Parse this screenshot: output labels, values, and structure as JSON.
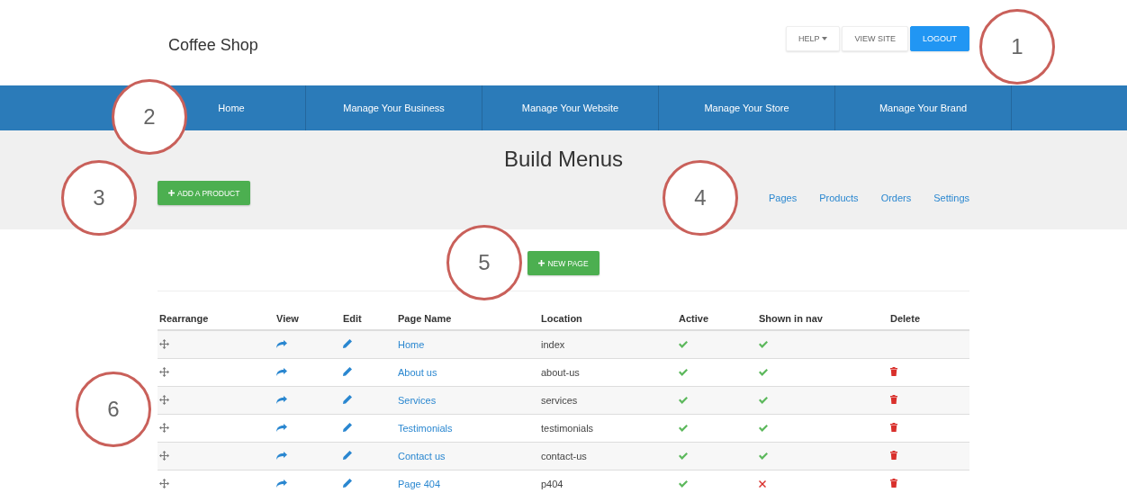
{
  "header": {
    "brand": "Coffee Shop",
    "buttons": [
      {
        "label": "HELP",
        "kind": "dropdown"
      },
      {
        "label": "VIEW SITE",
        "kind": "default"
      },
      {
        "label": "LOGOUT",
        "kind": "primary"
      }
    ]
  },
  "nav": [
    {
      "label": "Home"
    },
    {
      "label": "Manage Your Business"
    },
    {
      "label": "Manage Your Website"
    },
    {
      "label": "Manage Your Store"
    },
    {
      "label": "Manage Your Brand"
    }
  ],
  "page_title": "Build Menus",
  "add_button": "ADD A PRODUCT",
  "sub_links": [
    "Pages",
    "Products",
    "Orders",
    "Settings"
  ],
  "new_page_button": "NEW PAGE",
  "table": {
    "columns": [
      "Rearrange",
      "View",
      "Edit",
      "Page Name",
      "Location",
      "Active",
      "Shown in nav",
      "Delete"
    ],
    "rows": [
      {
        "name": "Home",
        "location": "index",
        "active": true,
        "shown_in_nav": true,
        "deletable": false
      },
      {
        "name": "About us",
        "location": "about-us",
        "active": true,
        "shown_in_nav": true,
        "deletable": true
      },
      {
        "name": "Services",
        "location": "services",
        "active": true,
        "shown_in_nav": true,
        "deletable": true
      },
      {
        "name": "Testimonials",
        "location": "testimonials",
        "active": true,
        "shown_in_nav": true,
        "deletable": true
      },
      {
        "name": "Contact us",
        "location": "contact-us",
        "active": true,
        "shown_in_nav": true,
        "deletable": true
      },
      {
        "name": "Page 404",
        "location": "p404",
        "active": true,
        "shown_in_nav": false,
        "deletable": true
      }
    ]
  },
  "callouts": [
    "1",
    "2",
    "3",
    "4",
    "5",
    "6"
  ]
}
